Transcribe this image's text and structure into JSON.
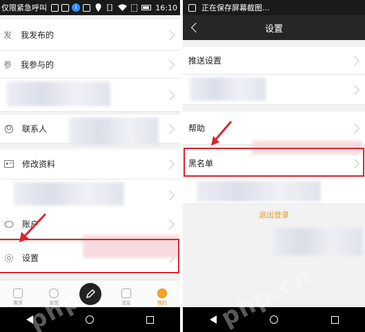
{
  "left": {
    "status": {
      "carrier_text": "仅限紧急呼叫",
      "time": "16:10",
      "info_badge": "i"
    },
    "menu": [
      {
        "icon": "发",
        "label": "我发布的"
      },
      {
        "icon": "参",
        "label": "我参与的"
      },
      {
        "icon": "person-icon",
        "label": "联系人"
      },
      {
        "icon": "id-card-icon",
        "label": "修改资料"
      },
      {
        "icon": "piggy-bank-icon",
        "label": "账户"
      },
      {
        "icon": "gear-icon",
        "label": "设置"
      }
    ],
    "tabs": [
      {
        "label": "需求",
        "active": false
      },
      {
        "label": "发现",
        "active": false
      },
      {
        "label": "",
        "active": false
      },
      {
        "label": "消息",
        "active": false
      },
      {
        "label": "我的",
        "active": true
      }
    ]
  },
  "right": {
    "status": {
      "text": "正在保存屏幕截图..."
    },
    "title": "设置",
    "items": [
      {
        "label": "推送设置"
      },
      {
        "label": "帮助"
      },
      {
        "label": "黑名单"
      }
    ],
    "logout": "退出登录"
  },
  "colors": {
    "highlight": "#d9252b",
    "accent": "#e98a1a",
    "titlebar": "#262626"
  }
}
